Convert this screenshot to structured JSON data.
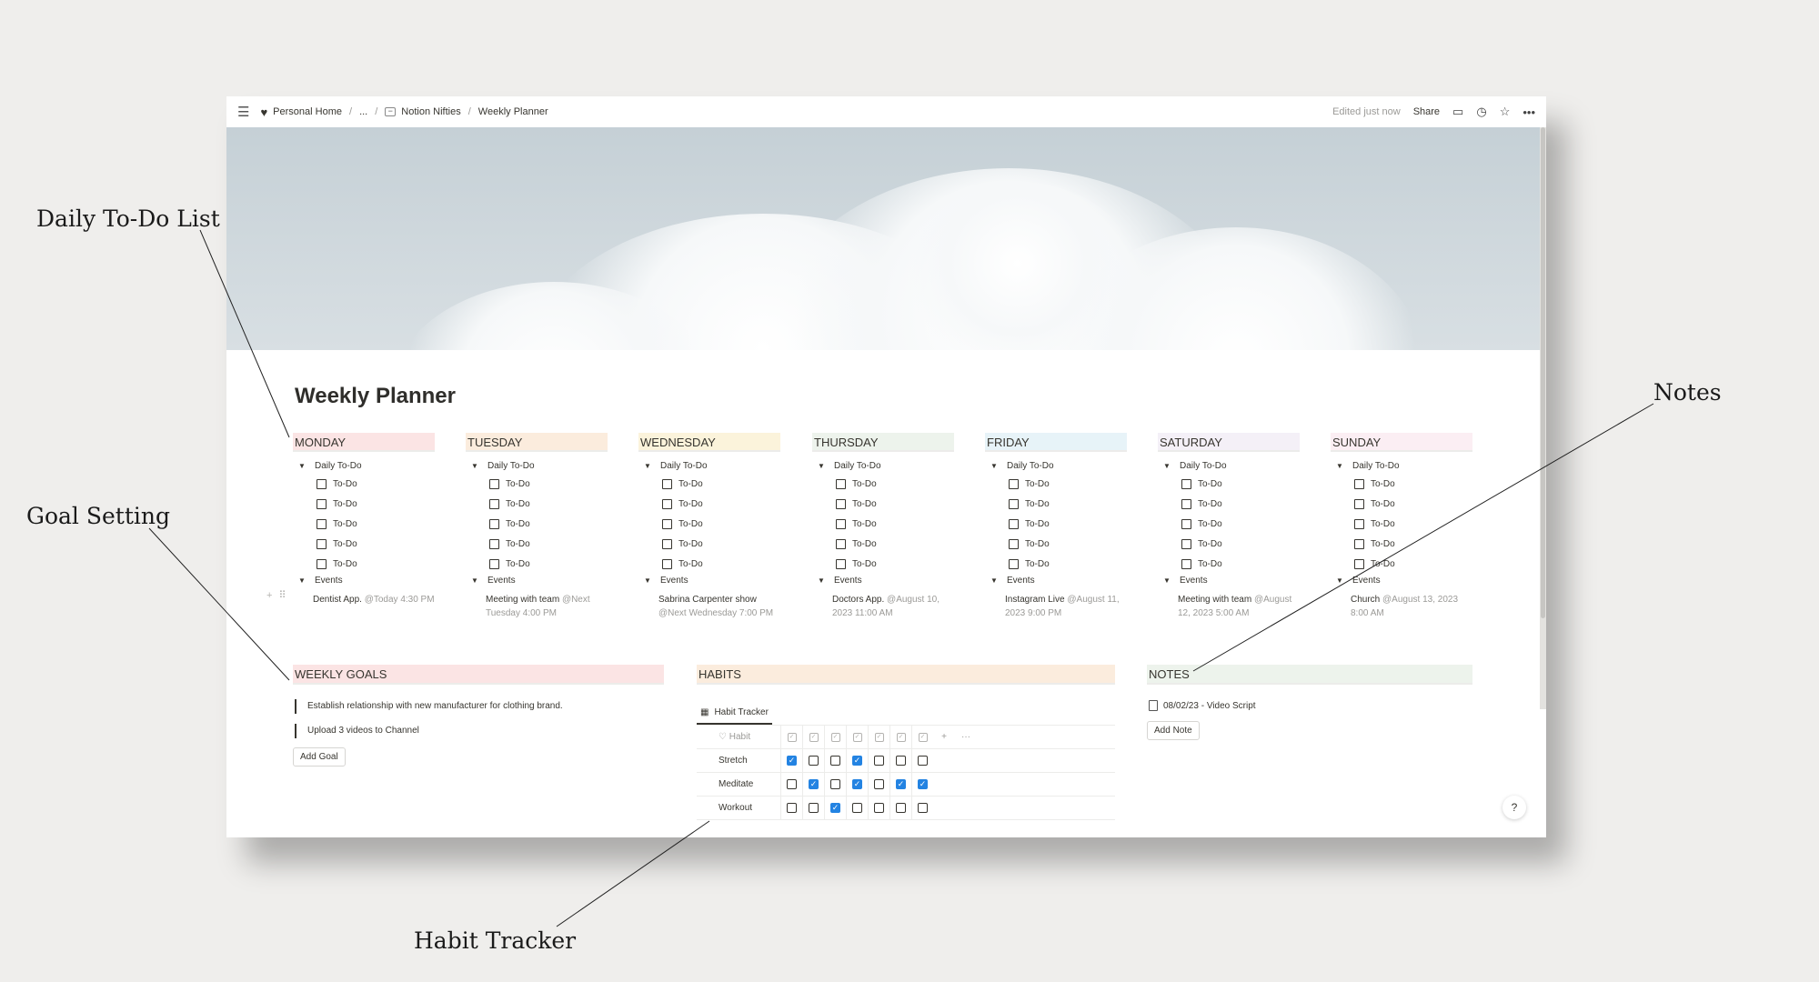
{
  "annotations": {
    "daily_todo": "Daily To-Do List",
    "goal_setting": "Goal Setting",
    "notes": "Notes",
    "habit_tracker": "Habit Tracker"
  },
  "topbar": {
    "breadcrumb": [
      "Personal Home",
      "...",
      "Notion Nifties",
      "Weekly Planner"
    ],
    "edited": "Edited just now",
    "share": "Share"
  },
  "page": {
    "title": "Weekly Planner"
  },
  "days": [
    {
      "name": "MONDAY",
      "color": "#fbe4e4",
      "toggle": "Daily To-Do",
      "todos": [
        "To-Do",
        "To-Do",
        "To-Do",
        "To-Do",
        "To-Do"
      ],
      "events_label": "Events",
      "event_title": "Dentist App.",
      "event_when": "@Today 4:30 PM"
    },
    {
      "name": "TUESDAY",
      "color": "#fbecdd",
      "toggle": "Daily To-Do",
      "todos": [
        "To-Do",
        "To-Do",
        "To-Do",
        "To-Do",
        "To-Do"
      ],
      "events_label": "Events",
      "event_title": "Meeting with team",
      "event_when": "@Next Tuesday 4:00 PM"
    },
    {
      "name": "WEDNESDAY",
      "color": "#fbf3db",
      "toggle": "Daily To-Do",
      "todos": [
        "To-Do",
        "To-Do",
        "To-Do",
        "To-Do",
        "To-Do"
      ],
      "events_label": "Events",
      "event_title": "Sabrina Carpenter show",
      "event_when": "@Next Wednesday 7:00 PM"
    },
    {
      "name": "THURSDAY",
      "color": "#edf3ec",
      "toggle": "Daily To-Do",
      "todos": [
        "To-Do",
        "To-Do",
        "To-Do",
        "To-Do",
        "To-Do"
      ],
      "events_label": "Events",
      "event_title": "Doctors App.",
      "event_when": "@August 10, 2023 11:00 AM"
    },
    {
      "name": "FRIDAY",
      "color": "#e7f3f8",
      "toggle": "Daily To-Do",
      "todos": [
        "To-Do",
        "To-Do",
        "To-Do",
        "To-Do",
        "To-Do"
      ],
      "events_label": "Events",
      "event_title": "Instagram Live",
      "event_when": "@August 11, 2023 9:00 PM"
    },
    {
      "name": "SATURDAY",
      "color": "#f4f0f7",
      "toggle": "Daily To-Do",
      "todos": [
        "To-Do",
        "To-Do",
        "To-Do",
        "To-Do",
        "To-Do"
      ],
      "events_label": "Events",
      "event_title": "Meeting with team",
      "event_when": "@August 12, 2023 5:00 AM"
    },
    {
      "name": "SUNDAY",
      "color": "#fbeef3",
      "toggle": "Daily To-Do",
      "todos": [
        "To-Do",
        "To-Do",
        "To-Do",
        "To-Do",
        "To-Do"
      ],
      "events_label": "Events",
      "event_title": "Church",
      "event_when": "@August 13, 2023 8:00 AM"
    }
  ],
  "goals": {
    "title": "WEEKLY GOALS",
    "color": "#fbe4e4",
    "items": [
      "Establish relationship with new manufacturer for clothing brand.",
      "Upload 3 videos to Channel"
    ],
    "button": "Add Goal"
  },
  "habits": {
    "title": "HABITS",
    "color": "#fbecdd",
    "tab": "Habit Tracker",
    "column_header": "Habit",
    "rows": [
      {
        "name": "Stretch",
        "checks": [
          true,
          false,
          false,
          true,
          false,
          false,
          false
        ]
      },
      {
        "name": "Meditate",
        "checks": [
          false,
          true,
          false,
          true,
          false,
          true,
          true
        ]
      },
      {
        "name": "Workout",
        "checks": [
          false,
          false,
          true,
          false,
          false,
          false,
          false
        ]
      }
    ]
  },
  "notes": {
    "title": "NOTES",
    "color": "#edf3ec",
    "items": [
      "08/02/23 - Video Script"
    ],
    "button": "Add Note"
  },
  "help": "?"
}
